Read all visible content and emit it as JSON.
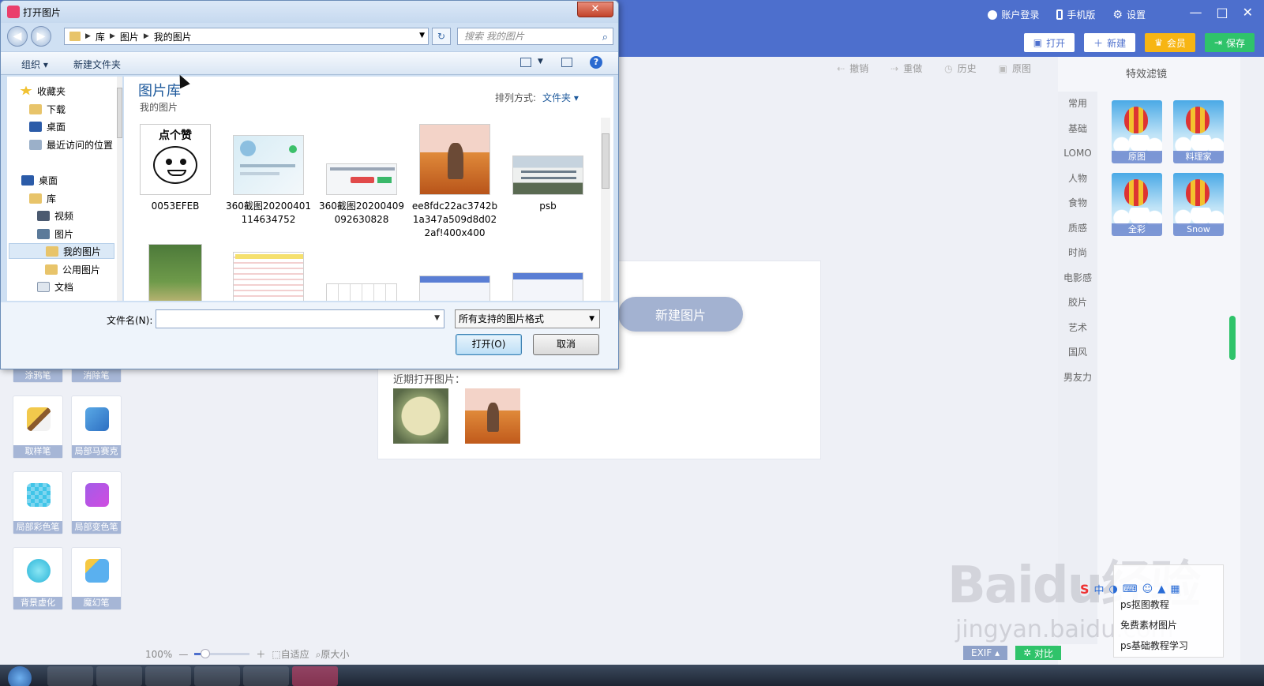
{
  "app": {
    "top_links": {
      "login": "账户登录",
      "mobile": "手机版",
      "settings": "设置"
    },
    "window_controls": {
      "min": "—",
      "max": "□",
      "close": "✕"
    },
    "top_buttons": {
      "open": "打开",
      "new": "新建",
      "vip": "会员",
      "save": "保存"
    },
    "history": {
      "undo": "撤销",
      "redo": "重做",
      "history": "历史",
      "original": "原图"
    },
    "right_panel": {
      "title": "特效滤镜",
      "categories": [
        "常用",
        "基础",
        "LOMO",
        "人物",
        "食物",
        "质感",
        "时尚",
        "电影感",
        "胶片",
        "艺术",
        "国风",
        "男友力"
      ],
      "filters": [
        "原图",
        "料理家",
        "全彩",
        "Snow"
      ]
    },
    "left_tools": {
      "top_row": [
        "涂鸦笔",
        "消除笔"
      ],
      "items": [
        "取样笔",
        "局部马赛克",
        "局部彩色笔",
        "局部变色笔",
        "背景虚化",
        "魔幻笔"
      ]
    },
    "canvas": {
      "new_image": "新建图片",
      "recent_label": "近期打开图片："
    },
    "bottom": {
      "zoom": "100%",
      "fit": "自适应",
      "original_size": "原大小",
      "zoom_fraction": 0.2
    },
    "bottom_right": {
      "exif": "EXIF",
      "compare": "对比"
    },
    "ad_links": [
      "ps抠图教程",
      "免费素材图片",
      "ps基础教程学习"
    ],
    "watermark": {
      "main": "Baidu经验",
      "sub": "jingyan.baidu.com"
    },
    "ime": {
      "logo": "S",
      "mode": "中"
    },
    "colors": {
      "header_blue": "#4d6fcd",
      "vip_gold": "#f7b513",
      "save_green": "#2fc36a"
    }
  },
  "dialog": {
    "title": "打开图片",
    "close_label": "✕",
    "nav": {
      "back": "◀",
      "forward": "▶",
      "refresh": "↻"
    },
    "breadcrumb": [
      "库",
      "图片",
      "我的图片"
    ],
    "search_placeholder": "搜索 我的图片",
    "toolbar": {
      "organize": "组织 ▾",
      "new_folder": "新建文件夹",
      "help": "?"
    },
    "nav_pane": [
      {
        "label": "收藏夹",
        "icon": "star-icon"
      },
      {
        "label": "下载",
        "icon": "download-folder-icon"
      },
      {
        "label": "桌面",
        "icon": "desktop-icon"
      },
      {
        "label": "最近访问的位置",
        "icon": "recent-places-icon"
      },
      {
        "label": "桌面",
        "icon": "desktop-icon"
      },
      {
        "label": "库",
        "icon": "library-icon"
      },
      {
        "label": "视频",
        "icon": "video-library-icon"
      },
      {
        "label": "图片",
        "icon": "pictures-library-icon"
      },
      {
        "label": "我的图片",
        "icon": "folder-icon"
      },
      {
        "label": "公用图片",
        "icon": "folder-icon"
      },
      {
        "label": "文档",
        "icon": "document-icon"
      }
    ],
    "library_title": "图片库",
    "library_subtitle": "我的图片",
    "arrange_label": "排列方式:",
    "arrange_value": "文件夹 ▾",
    "files": [
      {
        "name": "0053EFEB",
        "caption": "点个赞"
      },
      {
        "name": "360截图20200401114634752"
      },
      {
        "name": "360截图20200409092630828"
      },
      {
        "name": "ee8fdc22ac3742b1a347a509d8d022af!400x400"
      },
      {
        "name": "psb"
      }
    ],
    "filename_label": "文件名(N):",
    "filename_value": "",
    "filetype": "所有支持的图片格式",
    "open_button": "打开(O)",
    "cancel_button": "取消"
  }
}
